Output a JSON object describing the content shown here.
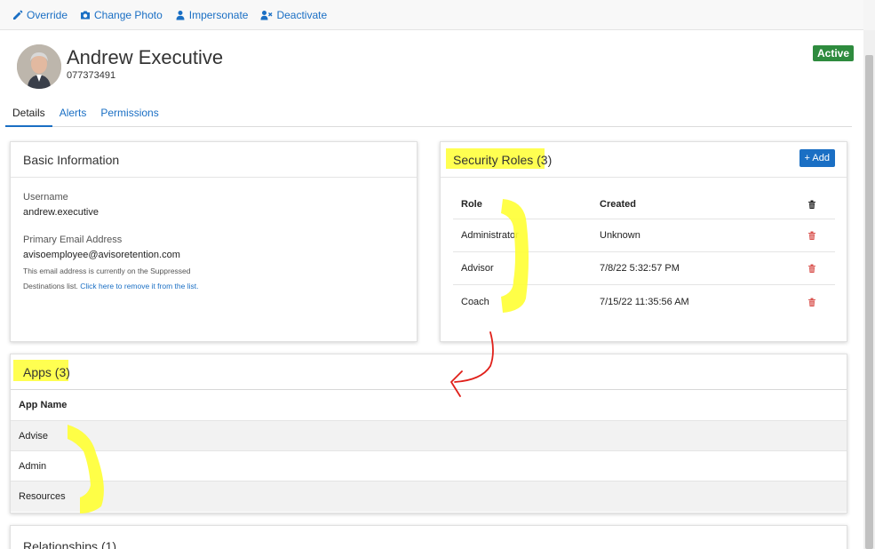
{
  "toolbar": {
    "items": [
      {
        "label": "Override",
        "icon": "pencil-icon"
      },
      {
        "label": "Change Photo",
        "icon": "camera-icon"
      },
      {
        "label": "Impersonate",
        "icon": "user-icon"
      },
      {
        "label": "Deactivate",
        "icon": "user-x-icon"
      }
    ]
  },
  "profile": {
    "name": "Andrew Executive",
    "id": "077373491",
    "status": "Active",
    "status_color": "#2e8b3e"
  },
  "tabs": [
    "Details",
    "Alerts",
    "Permissions"
  ],
  "basic_info": {
    "title": "Basic Information",
    "username_label": "Username",
    "username": "andrew.executive",
    "email_label": "Primary Email Address",
    "email": "avisoemployee@avisoretention.com",
    "note_prefix": "This email address is currently on the Suppressed Destinations list.",
    "note_link": "Click here to remove it from the list."
  },
  "security_roles": {
    "title": "Security Roles (3)",
    "add_label": "+ Add",
    "columns": [
      "Role",
      "Created"
    ],
    "rows": [
      {
        "role": "Administrator",
        "created": "Unknown"
      },
      {
        "role": "Advisor",
        "created": "7/8/22 5:32:57 PM"
      },
      {
        "role": "Coach",
        "created": "7/15/22 11:35:56 AM"
      }
    ]
  },
  "apps": {
    "title": "Apps (3)",
    "column": "App Name",
    "rows": [
      "Advise",
      "Admin",
      "Resources"
    ]
  },
  "relationships": {
    "title": "Relationships (1)"
  },
  "colors": {
    "accent": "#1a6fc4",
    "highlight": "#ffff33",
    "annotation": "#e0201a",
    "delete": "#d9534f"
  }
}
